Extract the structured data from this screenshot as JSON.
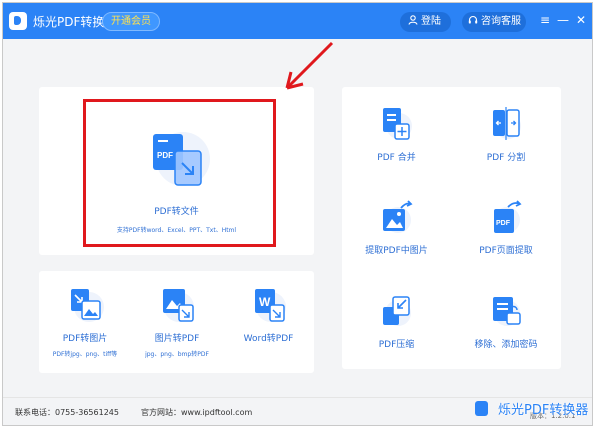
{
  "app": {
    "title": "烁光PDF转换器",
    "vip_label": "开通会员",
    "login_label": "登陆",
    "service_label": "咨询客服"
  },
  "window_controls": {
    "menu": "≡",
    "minimize": "—",
    "close": "✕"
  },
  "main_card": {
    "title": "PDF转文件",
    "subtitle": "支持PDF转word、Excel、PPT、Txt、Html",
    "icon_text": "PDF"
  },
  "bottom_cards": [
    {
      "title": "PDF转图片",
      "subtitle": "PDF转jpg、png、tiff等"
    },
    {
      "title": "图片转PDF",
      "subtitle": "jpg、png、bmp转PDF"
    },
    {
      "title": "Word转PDF",
      "subtitle": "",
      "icon_text": "W"
    }
  ],
  "tools": [
    {
      "label": "PDF 合并"
    },
    {
      "label": "PDF 分割"
    },
    {
      "label": "提取PDF中图片"
    },
    {
      "label": "PDF页面提取"
    },
    {
      "label": "PDF压缩"
    },
    {
      "label": "移除、添加密码"
    }
  ],
  "footer": {
    "phone": "联系电话：0755-36561245",
    "website": "官方网站：www.ipdftool.com",
    "version": "版本：1.2.0.1"
  },
  "watermark": "烁光PDF转换器",
  "colors": {
    "primary": "#2b83f6",
    "annotation": "#e0181d"
  }
}
